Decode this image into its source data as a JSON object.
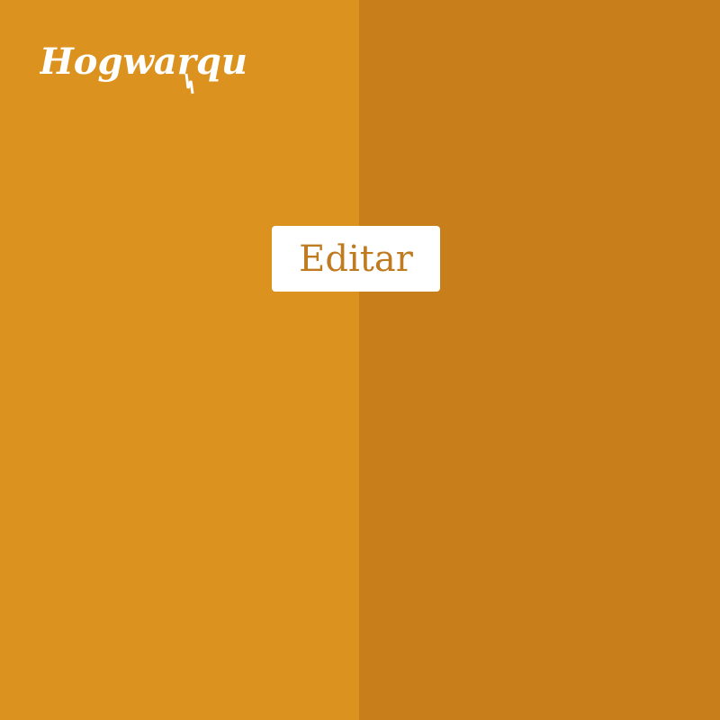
{
  "logo": {
    "text": "Hogwarquiz"
  },
  "edit_button": {
    "label": "Editar"
  },
  "colors": {
    "left_panel": "#db921e",
    "right_panel": "#c87f1b",
    "button_background": "#ffffff",
    "button_text": "#c07a1f",
    "logo_text": "#ffffff"
  }
}
